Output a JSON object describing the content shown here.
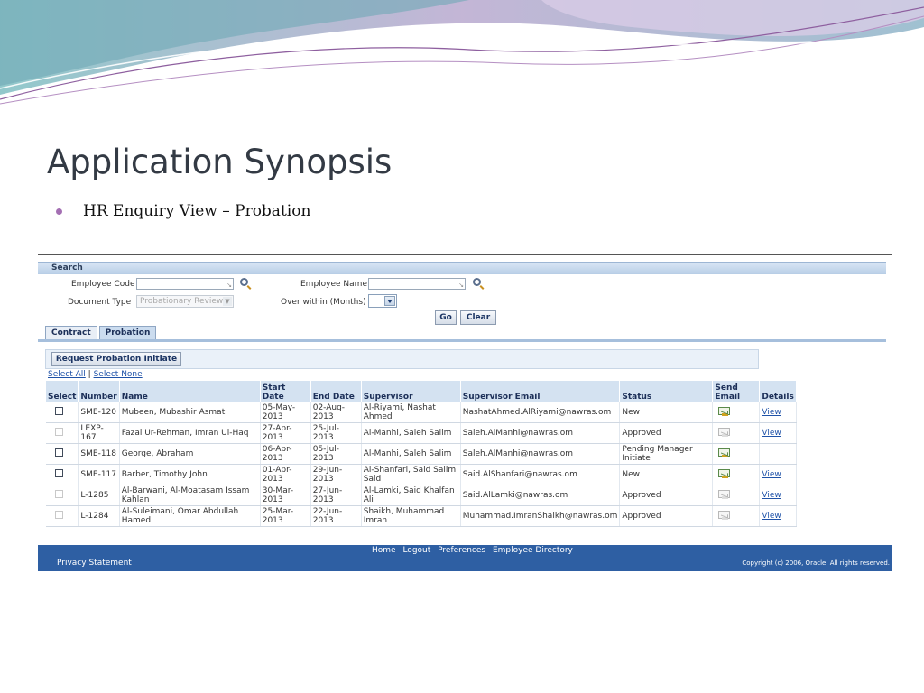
{
  "slide": {
    "title": "Application Synopsis",
    "bullet": "HR  Enquiry View – Probation",
    "accent": "#a46fb3"
  },
  "app": {
    "search_header": "Search",
    "fields": {
      "employee_code_label": "Employee Code",
      "employee_code_value": "",
      "employee_name_label": "Employee Name",
      "employee_name_value": "",
      "document_type_label": "Document Type",
      "document_type_value": "Probationary Review",
      "over_within_label": "Over within (Months)",
      "over_within_value": ""
    },
    "buttons": {
      "go": "Go",
      "clear": "Clear",
      "request": "Request Probation Initiate"
    },
    "tabs": [
      {
        "label": "Contract"
      },
      {
        "label": "Probation"
      }
    ],
    "links": {
      "select_all": "Select All",
      "separator": " | ",
      "select_none": "Select None"
    },
    "columns": {
      "select": "Select",
      "number": "Number",
      "name": "Name",
      "start": "Start Date",
      "end": "End Date",
      "supervisor": "Supervisor",
      "email": "Supervisor Email",
      "status": "Status",
      "send": "Send Email",
      "details": "Details"
    },
    "rows": [
      {
        "number": "SME-120",
        "name": "Mubeen, Mubashir Asmat",
        "start": "05-May-2013",
        "end": "02-Aug-2013",
        "supervisor": "Al-Riyami, Nashat Ahmed",
        "email": "NashatAhmed.AlRiyami@nawras.om",
        "status": "New",
        "details": "View"
      },
      {
        "number": "LEXP-167",
        "name": "Fazal Ur-Rehman, Imran Ul-Haq",
        "start": "27-Apr-2013",
        "end": "25-Jul-2013",
        "supervisor": "Al-Manhi, Saleh Salim",
        "email": "Saleh.AlManhi@nawras.om",
        "status": "Approved",
        "details": "View"
      },
      {
        "number": "SME-118",
        "name": "George, Abraham",
        "start": "06-Apr-2013",
        "end": "05-Jul-2013",
        "supervisor": "Al-Manhi, Saleh Salim",
        "email": "Saleh.AlManhi@nawras.om",
        "status": "Pending Manager Initiate",
        "details": ""
      },
      {
        "number": "SME-117",
        "name": "Barber, Timothy John",
        "start": "01-Apr-2013",
        "end": "29-Jun-2013",
        "supervisor": "Al-Shanfari, Said Salim Said",
        "email": "Said.AlShanfari@nawras.om",
        "status": "New",
        "details": "View"
      },
      {
        "number": "L-1285",
        "name": "Al-Barwani, Al-Moatasam Issam Kahlan",
        "start": "30-Mar-2013",
        "end": "27-Jun-2013",
        "supervisor": "Al-Lamki, Said Khalfan Ali",
        "email": "Said.AlLamki@nawras.om",
        "status": "Approved",
        "details": "View"
      },
      {
        "number": "L-1284",
        "name": "Al-Suleimani, Omar Abdullah Hamed",
        "start": "25-Mar-2013",
        "end": "22-Jun-2013",
        "supervisor": "Shaikh, Muhammad Imran",
        "email": "Muhammad.ImranShaikh@nawras.om",
        "status": "Approved",
        "details": "View"
      }
    ],
    "footer": {
      "links": [
        "Home",
        "Logout",
        "Preferences",
        "Employee Directory"
      ],
      "privacy": "Privacy Statement",
      "copyright": "Copyright (c) 2006, Oracle. All rights reserved."
    }
  }
}
